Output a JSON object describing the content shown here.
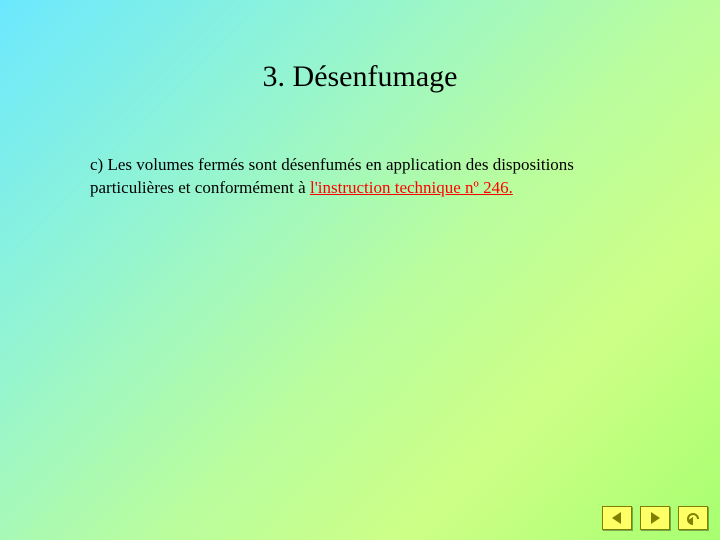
{
  "slide": {
    "title": "3. Désenfumage",
    "body_prefix": "c) Les volumes fermés sont désenfumés en application des dispositions particulières et conformément à ",
    "link_text": "l'instruction technique nº 246.",
    "link_color": "#ff0000",
    "accent_bg": "#ffff66"
  },
  "nav": {
    "prev": "Previous",
    "next": "Next",
    "home": "Return"
  }
}
